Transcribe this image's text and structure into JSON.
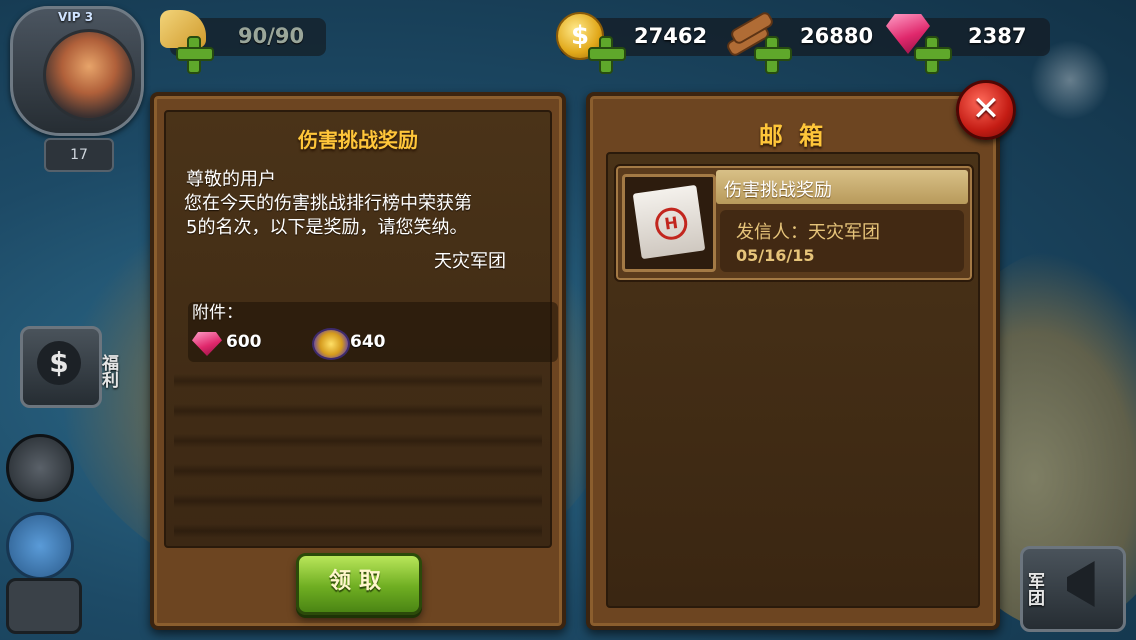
{
  "hud": {
    "vip_label": "VIP 3",
    "level": "17",
    "stamina": "90/90",
    "gold": "27462",
    "wood": "26880",
    "gems": "2387"
  },
  "sidebar": {
    "welfare_label": "福利",
    "army_label": "军团"
  },
  "message_panel": {
    "title": "伤害挑战奖励",
    "greeting": "尊敬的用户",
    "body_line1": " 您在今天的伤害挑战排行榜中荣获第",
    "body_line2": "5的名次，以下是奖励，请您笑纳。",
    "signature": "天灾军团",
    "attachments_label": "附件：",
    "attachments": [
      {
        "icon": "gem-icon",
        "value": "600"
      },
      {
        "icon": "badge-icon",
        "value": "640"
      }
    ],
    "claim_button": "领取"
  },
  "mailbox": {
    "title": "邮 箱",
    "items": [
      {
        "title": "伤害挑战奖励",
        "sender": "发信人：天灾军团",
        "date": "05/16/15",
        "icon": "scroll-icon"
      }
    ]
  },
  "colors": {
    "title_gold": "#ffc63a",
    "panel_brown": "#6d4521",
    "button_green": "#6fae22",
    "close_red": "#c41c14"
  }
}
